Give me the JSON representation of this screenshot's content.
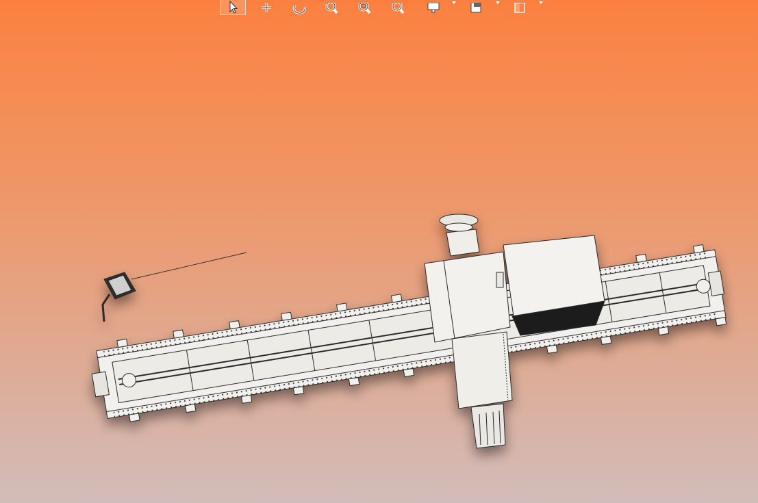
{
  "window": {
    "type": "3D CAD viewport"
  },
  "toolbar": {
    "items": [
      {
        "name": "select-icon",
        "active": true
      },
      {
        "name": "pan-icon"
      },
      {
        "name": "rotate-icon"
      },
      {
        "name": "zoom-in-out-icon"
      },
      {
        "name": "zoom-window-icon"
      },
      {
        "name": "zoom-fit-icon"
      },
      {
        "name": "display-style-icon",
        "dropdown": true
      },
      {
        "name": "view-orientation-icon",
        "dropdown": true
      },
      {
        "name": "section-view-icon",
        "dropdown": true
      }
    ]
  },
  "colors": {
    "background_top": "#fb8040",
    "background_bottom": "#d2bcba",
    "model_fill": "#f1f0ec",
    "model_edge": "#2a2a2a"
  }
}
